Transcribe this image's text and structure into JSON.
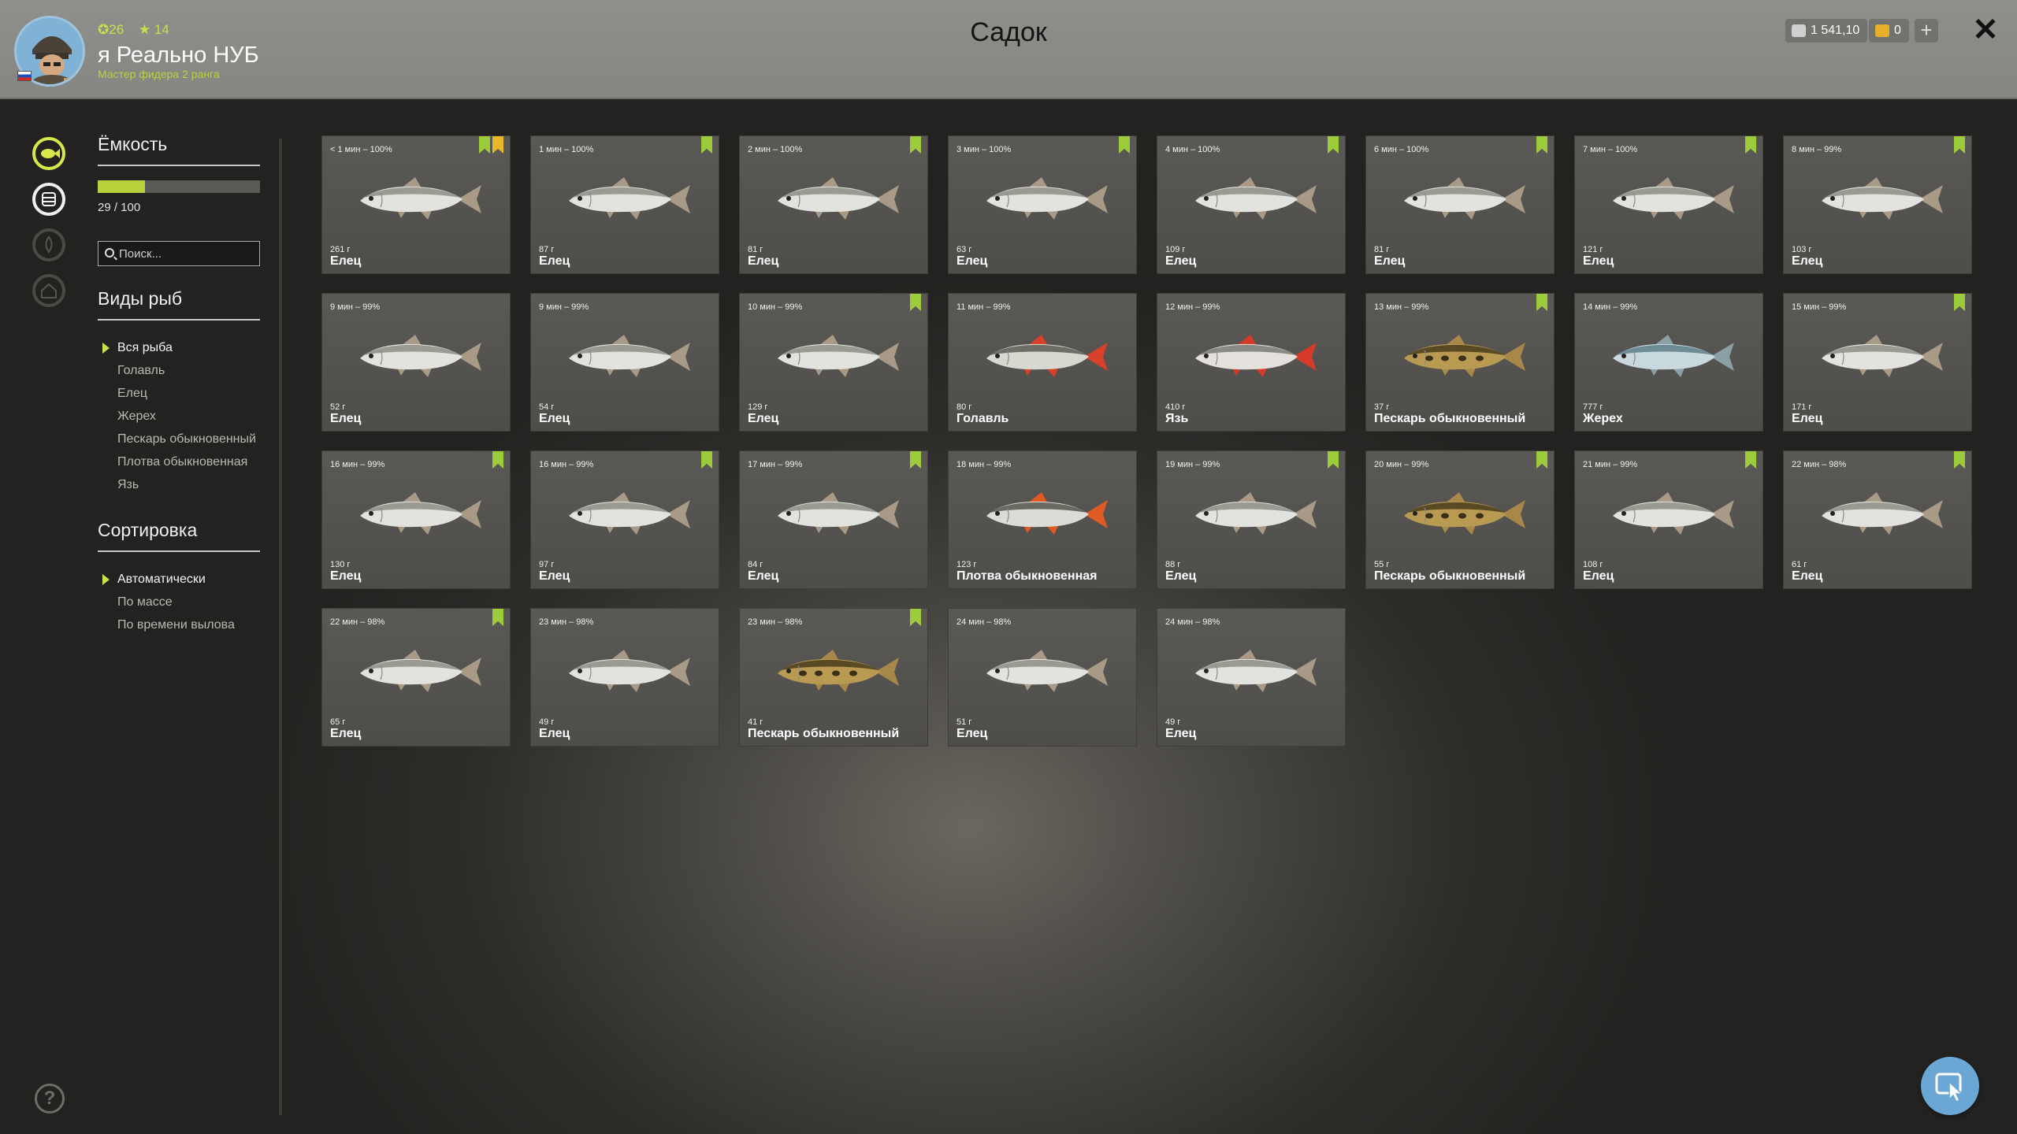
{
  "player": {
    "avatar_icon": "angler-avatar",
    "flag_icon": "russia-flag-icon",
    "level_label": "✪26",
    "stars_label": "★ 14",
    "name": "я Реально НУБ",
    "rank": "Мастер фидера 2 ранга"
  },
  "header": {
    "title": "Садок",
    "silver": "1 541,10",
    "gold": "0",
    "plus_label": "+",
    "close_label": "✕"
  },
  "capacity": {
    "title": "Ёмкость",
    "current": 29,
    "max": 100,
    "label": "29 / 100"
  },
  "search": {
    "placeholder": "Поиск..."
  },
  "species": {
    "title": "Виды рыб",
    "items": [
      "Вся рыба",
      "Голавль",
      "Елец",
      "Жерех",
      "Пескарь обыкновенный",
      "Плотва обыкновенная",
      "Язь"
    ],
    "selected_index": 0
  },
  "sorting": {
    "title": "Сортировка",
    "items": [
      "Автоматически",
      "По массе",
      "По времени вылова"
    ],
    "selected_index": 0
  },
  "fish": [
    {
      "time": "< 1 мин – 100%",
      "weight": "261 г",
      "name": "Елец",
      "bookmarks": [
        "green",
        "gold"
      ],
      "kind": "dace"
    },
    {
      "time": "1 мин – 100%",
      "weight": "87 г",
      "name": "Елец",
      "bookmarks": [
        "green"
      ],
      "kind": "dace"
    },
    {
      "time": "2 мин – 100%",
      "weight": "81 г",
      "name": "Елец",
      "bookmarks": [
        "green"
      ],
      "kind": "dace"
    },
    {
      "time": "3 мин – 100%",
      "weight": "63 г",
      "name": "Елец",
      "bookmarks": [
        "green"
      ],
      "kind": "dace"
    },
    {
      "time": "4 мин – 100%",
      "weight": "109 г",
      "name": "Елец",
      "bookmarks": [
        "green"
      ],
      "kind": "dace"
    },
    {
      "time": "6 мин – 100%",
      "weight": "81 г",
      "name": "Елец",
      "bookmarks": [
        "green"
      ],
      "kind": "dace"
    },
    {
      "time": "7 мин – 100%",
      "weight": "121 г",
      "name": "Елец",
      "bookmarks": [
        "green"
      ],
      "kind": "dace"
    },
    {
      "time": "8 мин – 99%",
      "weight": "103 г",
      "name": "Елец",
      "bookmarks": [
        "green"
      ],
      "kind": "dace"
    },
    {
      "time": "9 мин – 99%",
      "weight": "52 г",
      "name": "Елец",
      "bookmarks": [],
      "kind": "dace"
    },
    {
      "time": "9 мин – 99%",
      "weight": "54 г",
      "name": "Елец",
      "bookmarks": [],
      "kind": "dace"
    },
    {
      "time": "10 мин – 99%",
      "weight": "129 г",
      "name": "Елец",
      "bookmarks": [
        "green"
      ],
      "kind": "dace"
    },
    {
      "time": "11 мин – 99%",
      "weight": "80 г",
      "name": "Голавль",
      "bookmarks": [],
      "kind": "chub"
    },
    {
      "time": "12 мин – 99%",
      "weight": "410 г",
      "name": "Язь",
      "bookmarks": [],
      "kind": "ide"
    },
    {
      "time": "13 мин – 99%",
      "weight": "37 г",
      "name": "Пескарь обыкновенный",
      "bookmarks": [
        "green"
      ],
      "kind": "gudgeon"
    },
    {
      "time": "14 мин – 99%",
      "weight": "777 г",
      "name": "Жерех",
      "bookmarks": [],
      "kind": "asp"
    },
    {
      "time": "15 мин – 99%",
      "weight": "171 г",
      "name": "Елец",
      "bookmarks": [
        "green"
      ],
      "kind": "dace"
    },
    {
      "time": "16 мин – 99%",
      "weight": "130 г",
      "name": "Елец",
      "bookmarks": [
        "green"
      ],
      "kind": "dace"
    },
    {
      "time": "16 мин – 99%",
      "weight": "97 г",
      "name": "Елец",
      "bookmarks": [
        "green"
      ],
      "kind": "dace"
    },
    {
      "time": "17 мин – 99%",
      "weight": "84 г",
      "name": "Елец",
      "bookmarks": [
        "green"
      ],
      "kind": "dace"
    },
    {
      "time": "18 мин – 99%",
      "weight": "123 г",
      "name": "Плотва обыкновенная",
      "bookmarks": [],
      "kind": "roach"
    },
    {
      "time": "19 мин – 99%",
      "weight": "88 г",
      "name": "Елец",
      "bookmarks": [
        "green"
      ],
      "kind": "dace"
    },
    {
      "time": "20 мин – 99%",
      "weight": "55 г",
      "name": "Пескарь обыкновенный",
      "bookmarks": [
        "green"
      ],
      "kind": "gudgeon"
    },
    {
      "time": "21 мин – 99%",
      "weight": "108 г",
      "name": "Елец",
      "bookmarks": [
        "green"
      ],
      "kind": "dace"
    },
    {
      "time": "22 мин – 98%",
      "weight": "61 г",
      "name": "Елец",
      "bookmarks": [
        "green"
      ],
      "kind": "dace"
    },
    {
      "time": "22 мин – 98%",
      "weight": "65 г",
      "name": "Елец",
      "bookmarks": [
        "green"
      ],
      "kind": "dace"
    },
    {
      "time": "23 мин – 98%",
      "weight": "49 г",
      "name": "Елец",
      "bookmarks": [],
      "kind": "dace"
    },
    {
      "time": "23 мин – 98%",
      "weight": "41 г",
      "name": "Пескарь обыкновенный",
      "bookmarks": [
        "green"
      ],
      "kind": "gudgeon"
    },
    {
      "time": "24 мин – 98%",
      "weight": "51 г",
      "name": "Елец",
      "bookmarks": [],
      "kind": "dace"
    },
    {
      "time": "24 мин – 98%",
      "weight": "49 г",
      "name": "Елец",
      "bookmarks": [],
      "kind": "dace"
    }
  ],
  "fish_colors": {
    "dace": {
      "body": "#e2e2de",
      "back": "#9a9a92",
      "fin": "#a89a86"
    },
    "chub": {
      "body": "#d8d8d0",
      "back": "#6e6e66",
      "fin": "#d8402a"
    },
    "ide": {
      "body": "#e4e0dc",
      "back": "#8a8a84",
      "fin": "#d83a2a"
    },
    "gudgeon": {
      "body": "#b89a52",
      "back": "#5a4a24",
      "fin": "#a8884a"
    },
    "asp": {
      "body": "#c8d8dc",
      "back": "#6e8c96",
      "fin": "#8aa0a4"
    },
    "roach": {
      "body": "#dcdcd6",
      "back": "#6a6a62",
      "fin": "#e05a24"
    }
  },
  "accent": "#b8d23c",
  "rail_icons": [
    "fish-icon",
    "keepnet-icon",
    "campfire-icon",
    "home-icon"
  ],
  "help_label": "?",
  "help_icon": "help-icon",
  "cursor_icon": "pointer-cursor-icon"
}
